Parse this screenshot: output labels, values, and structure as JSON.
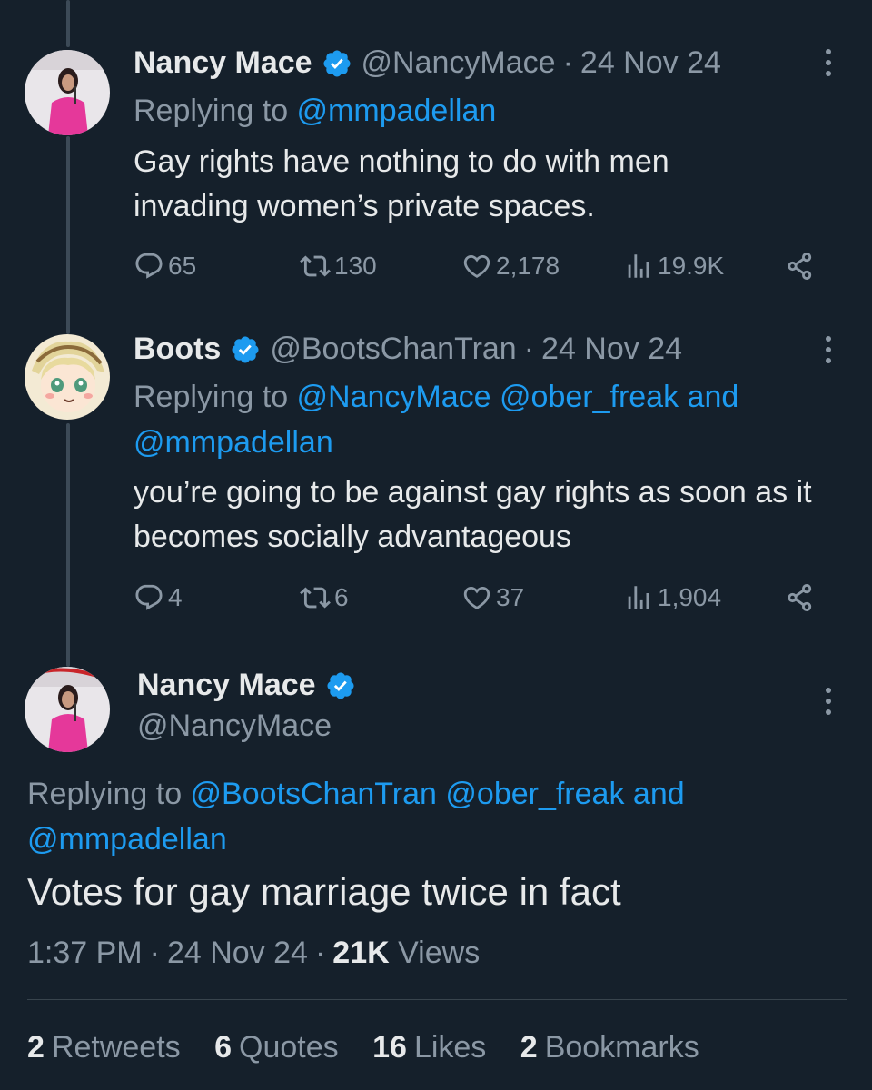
{
  "colors": {
    "background": "#15202b",
    "accent": "#1d9bf0",
    "muted": "#8b98a5",
    "text": "#e7e9ea"
  },
  "tweet1": {
    "name": "Nancy Mace",
    "handle": "@NancyMace",
    "date": "24 Nov 24",
    "replying_prefix": "Replying to ",
    "replying_to": [
      "@mmpadellan"
    ],
    "text": "Gay rights have nothing to do with men invading women’s private spaces.",
    "replies": "65",
    "retweets": "130",
    "likes": "2,178",
    "views": "19.9K"
  },
  "tweet2": {
    "name": "Boots",
    "handle": "@BootsChanTran",
    "date": "24 Nov 24",
    "replying_prefix": "Replying to ",
    "mention1": "@NancyMace",
    "mention2": "@ober_freak",
    "and_word": "and",
    "mention3": "@mmpadellan",
    "text": "you’re going to be against gay rights as soon as it becomes socially advantageous",
    "replies": "4",
    "retweets": "6",
    "likes": "37",
    "views": "1,904"
  },
  "main_tweet": {
    "name": "Nancy Mace",
    "handle": "@NancyMace",
    "replying_prefix": "Replying to ",
    "mention1": "@BootsChanTran",
    "mention2": "@ober_freak",
    "and_word": "and",
    "mention3": "@mmpadellan",
    "text": "Votes for gay marriage twice in fact",
    "time": "1:37 PM",
    "date": "24 Nov 24",
    "views_count": "21K",
    "views_label": "Views",
    "stats": {
      "retweets_count": "2",
      "retweets_label": "Retweets",
      "quotes_count": "6",
      "quotes_label": "Quotes",
      "likes_count": "16",
      "likes_label": "Likes",
      "bookmarks_count": "2",
      "bookmarks_label": "Bookmarks"
    }
  },
  "icons": {
    "reply": "reply-icon",
    "retweet": "retweet-icon",
    "like": "heart-icon",
    "views": "views-icon",
    "share": "share-icon",
    "verified": "verified-badge-icon",
    "more": "more-icon"
  }
}
